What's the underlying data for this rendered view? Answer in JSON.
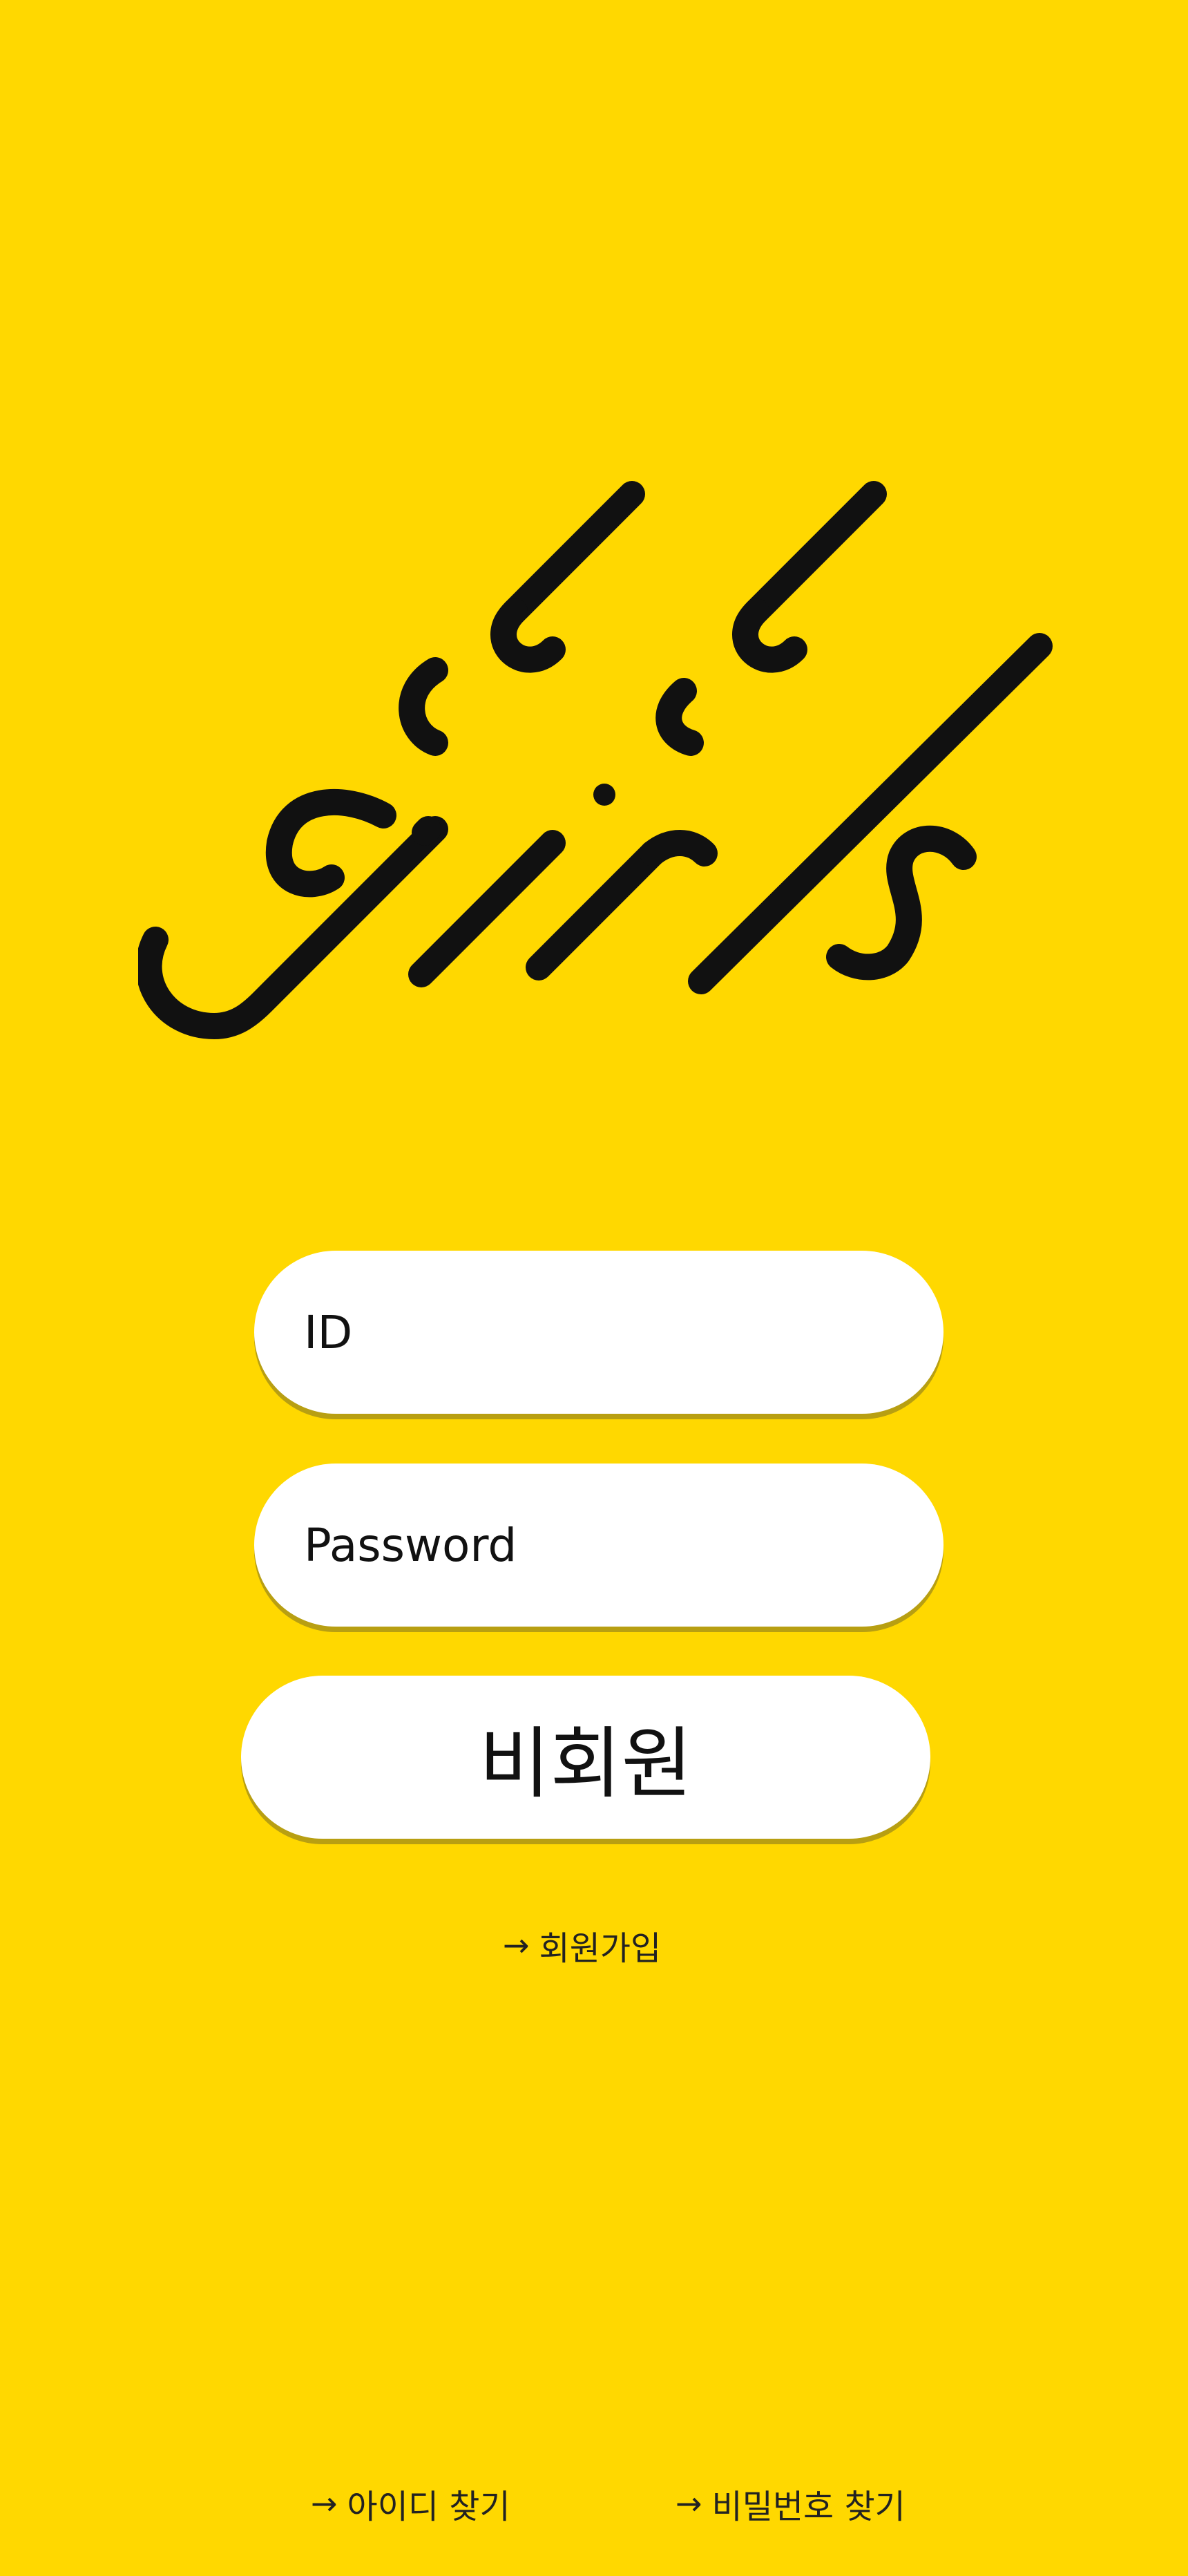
{
  "app": {
    "logo_name": "girls-logo",
    "background_color": "#FFD800",
    "accent_shadow_color": "#B89F12"
  },
  "login": {
    "id_placeholder": "ID",
    "password_placeholder": "Password",
    "guest_button_label": "비회원"
  },
  "links": {
    "arrow_icon": "→",
    "signup_label": "회원가입",
    "find_id_label": "아이디 찾기",
    "find_password_label": "비밀번호 찾기"
  }
}
